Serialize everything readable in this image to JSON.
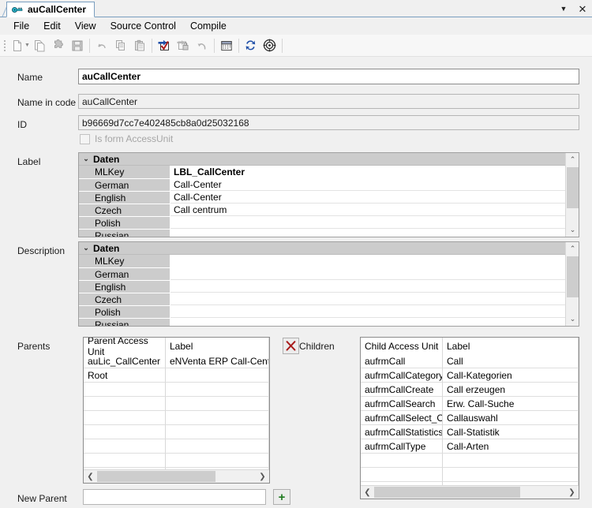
{
  "window": {
    "tab_title": "auCallCenter",
    "tab_icon": "access-unit-key-icon",
    "dropdown_glyph": "▼",
    "close_glyph": "✕"
  },
  "menubar": {
    "items": [
      {
        "label": "File"
      },
      {
        "label": "Edit"
      },
      {
        "label": "View"
      },
      {
        "label": "Source Control"
      },
      {
        "label": "Compile"
      }
    ]
  },
  "toolbar": {
    "buttons": [
      {
        "name": "new-document-icon",
        "enabled": false,
        "caret": true
      },
      {
        "name": "copy-document-icon",
        "enabled": false,
        "caret": false
      },
      {
        "name": "puzzle-piece-icon",
        "enabled": false,
        "caret": false
      },
      {
        "name": "save-icon",
        "enabled": false,
        "caret": false
      },
      {
        "name": "undo-icon",
        "enabled": false,
        "caret": false
      },
      {
        "name": "copy-icon",
        "enabled": false,
        "caret": false
      },
      {
        "name": "paste-icon",
        "enabled": false,
        "caret": false
      },
      {
        "name": "check-out-icon",
        "enabled": true,
        "caret": false
      },
      {
        "name": "check-in-lock-icon",
        "enabled": false,
        "caret": false
      },
      {
        "name": "undo-checkout-icon",
        "enabled": false,
        "caret": false
      },
      {
        "name": "history-calendar-icon",
        "enabled": true,
        "caret": false
      },
      {
        "name": "refresh-sync-icon",
        "enabled": true,
        "caret": false
      },
      {
        "name": "target-compile-icon",
        "enabled": true,
        "caret": false
      }
    ]
  },
  "form": {
    "name": {
      "label": "Name",
      "value": "auCallCenter"
    },
    "name_in_code": {
      "label": "Name in code",
      "value": "auCallCenter"
    },
    "id": {
      "label": "ID",
      "value": "b96669d7cc7e402485cb8a0d25032168"
    },
    "is_form_access_unit": {
      "label": "Is form AccessUnit",
      "checked": false
    },
    "label_section": {
      "label": "Label"
    },
    "description_section": {
      "label": "Description"
    },
    "parents_section": {
      "label": "Parents"
    },
    "children_section": {
      "label": "Children"
    },
    "new_parent": {
      "label": "New Parent",
      "value": "",
      "add_button": "+"
    },
    "delete_button": "✕"
  },
  "label_grid": {
    "group": "Daten",
    "expander": "⌄",
    "rows": [
      {
        "name": "MLKey",
        "value": "LBL_CallCenter"
      },
      {
        "name": "German",
        "value": "Call-Center"
      },
      {
        "name": "English",
        "value": "Call-Center"
      },
      {
        "name": "Czech",
        "value": "Call centrum"
      },
      {
        "name": "Polish",
        "value": ""
      },
      {
        "name": "Russian",
        "value": ""
      }
    ]
  },
  "description_grid": {
    "group": "Daten",
    "expander": "⌄",
    "rows": [
      {
        "name": "MLKey",
        "value": ""
      },
      {
        "name": "German",
        "value": ""
      },
      {
        "name": "English",
        "value": ""
      },
      {
        "name": "Czech",
        "value": ""
      },
      {
        "name": "Polish",
        "value": ""
      },
      {
        "name": "Russian",
        "value": ""
      }
    ]
  },
  "parents_grid": {
    "columns": [
      "Parent Access Unit",
      "Label"
    ],
    "rows": [
      [
        "auLic_CallCenter",
        "eNVenta ERP Call-Center"
      ],
      [
        "Root",
        ""
      ]
    ],
    "empty_rows": 8,
    "scroll_left_glyph": "❮",
    "scroll_right_glyph": "❯"
  },
  "children_grid": {
    "columns": [
      "Child Access Unit",
      "Label"
    ],
    "rows": [
      [
        "aufrmCall",
        "Call"
      ],
      [
        "aufrmCallCategory",
        "Call-Kategorien"
      ],
      [
        "aufrmCallCreate",
        "Call erzeugen"
      ],
      [
        "aufrmCallSearch",
        "Erw. Call-Suche"
      ],
      [
        "aufrmCallSelect_Old",
        "Callauswahl"
      ],
      [
        "aufrmCallStatistics",
        "Call-Statistik"
      ],
      [
        "aufrmCallType",
        "Call-Arten"
      ]
    ],
    "empty_rows": 4,
    "scroll_left_glyph": "❮",
    "scroll_right_glyph": "❯"
  },
  "scrollbars": {
    "up_glyph": "⌃",
    "down_glyph": "⌄"
  },
  "colors": {
    "window_bg": "#f0f0f0",
    "tab_border": "#7a9ebf",
    "grid_header_bg": "#cccccc",
    "accent_blue": "#1f4fa8",
    "delete_red": "#a81b1b",
    "add_green": "#1f7a1f"
  }
}
